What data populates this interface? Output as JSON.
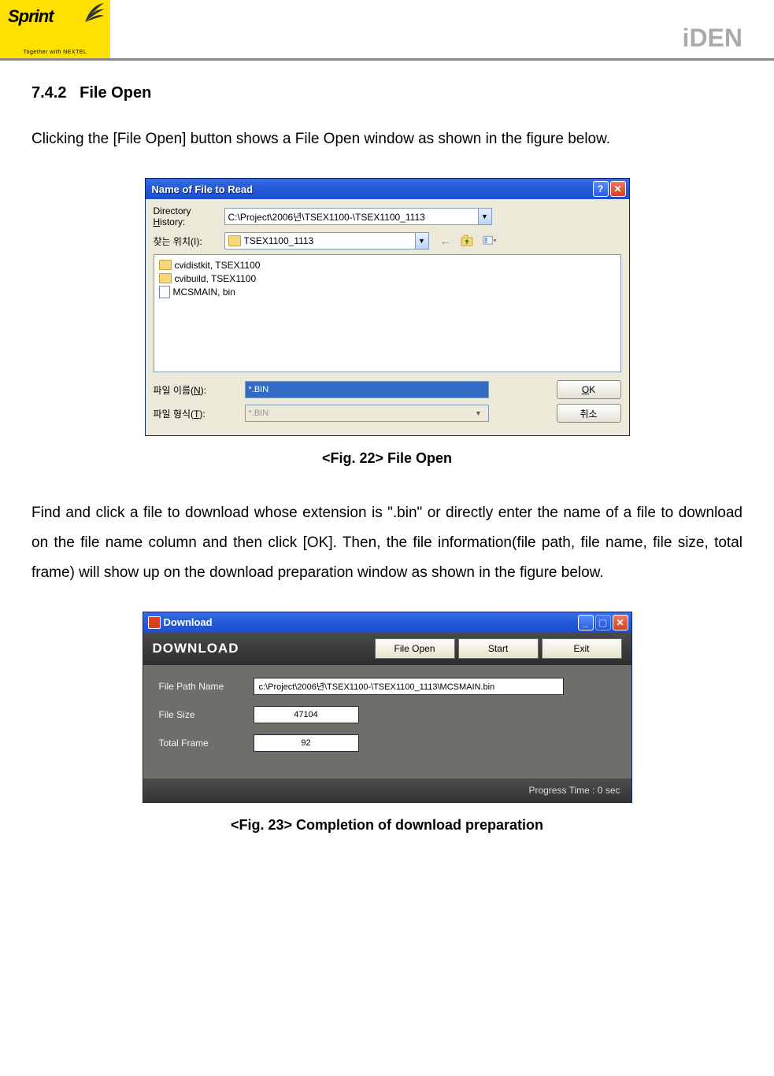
{
  "header": {
    "sprint_name": "Sprint",
    "sprint_tagline": "Together with NEXTEL",
    "iden": "iDEN"
  },
  "section": {
    "number": "7.4.2",
    "title": "File Open",
    "intro": "Clicking the [File Open] button shows a File Open window as shown in the figure below."
  },
  "fig22": {
    "caption": "<Fig. 22> File Open",
    "window_title": "Name of File to Read",
    "dir_history_label": "Directory History:",
    "dir_history_value": "C:\\Project\\2006년\\TSEX1100-\\TSEX1100_1113",
    "lookin_label": "찾는 위치(I):",
    "lookin_value": "TSEX1100_1113",
    "files": [
      "cvidistkit, TSEX1100",
      "cvibuild, TSEX1100",
      "MCSMAIN, bin"
    ],
    "filename_label": "파일 이름(N):",
    "filename_value": "*.BIN",
    "filetype_label": "파일 형식(T):",
    "filetype_value": "*.BIN",
    "ok_label": "OK",
    "cancel_label": "취소"
  },
  "para2": "Find and click a file to download whose extension is \".bin\" or directly enter the name of a file to download on the file name column and then click [OK]. Then, the file information(file path, file name, file size, total frame) will show up on the download preparation window as shown in the figure below.",
  "fig23": {
    "caption": "<Fig. 23> Completion of download preparation",
    "window_title": "Download",
    "heading": "DOWNLOAD",
    "buttons": {
      "file_open": "File Open",
      "start": "Start",
      "exit": "Exit"
    },
    "path_label": "File Path Name",
    "path_value": "c:\\Project\\2006년\\TSEX1100-\\TSEX1100_1113\\MCSMAIN.bin",
    "size_label": "File Size",
    "size_value": "47104",
    "frame_label": "Total Frame",
    "frame_value": "92",
    "progress": "Progress Time :  0 sec"
  }
}
